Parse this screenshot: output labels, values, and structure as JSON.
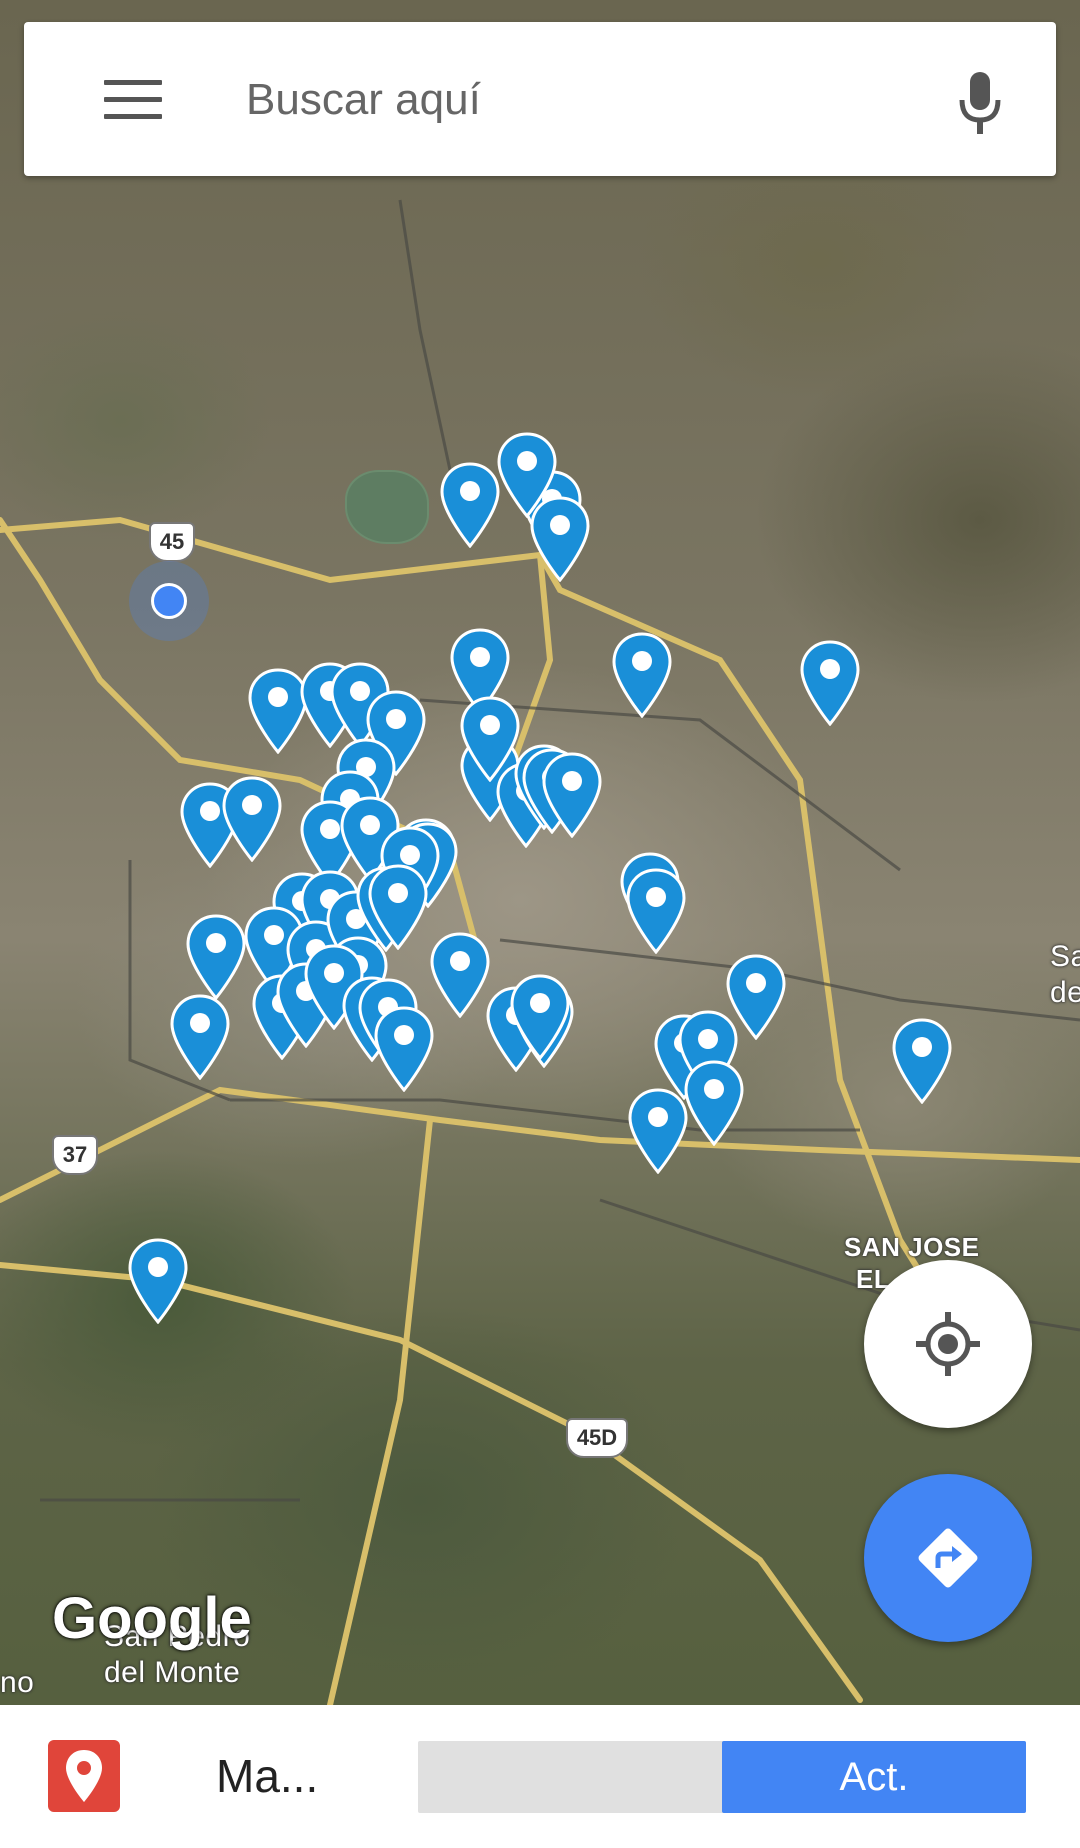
{
  "search": {
    "placeholder": "Buscar aquí"
  },
  "map": {
    "labels": {
      "place_1": "SAN JOSE",
      "place_2": "EL",
      "place_3": "San Pedro",
      "place_4": "del Monte",
      "edge_1": "Sa",
      "edge_2": "de",
      "edge_3": "no"
    },
    "shields": {
      "hwy_45": "45",
      "hwy_37": "37",
      "hwy_45d": "45D"
    },
    "attribution": "Google",
    "pin_color": "#1a8fd8"
  },
  "bottom_bar": {
    "app_name": "Ma...",
    "action_label": "Act."
  }
}
